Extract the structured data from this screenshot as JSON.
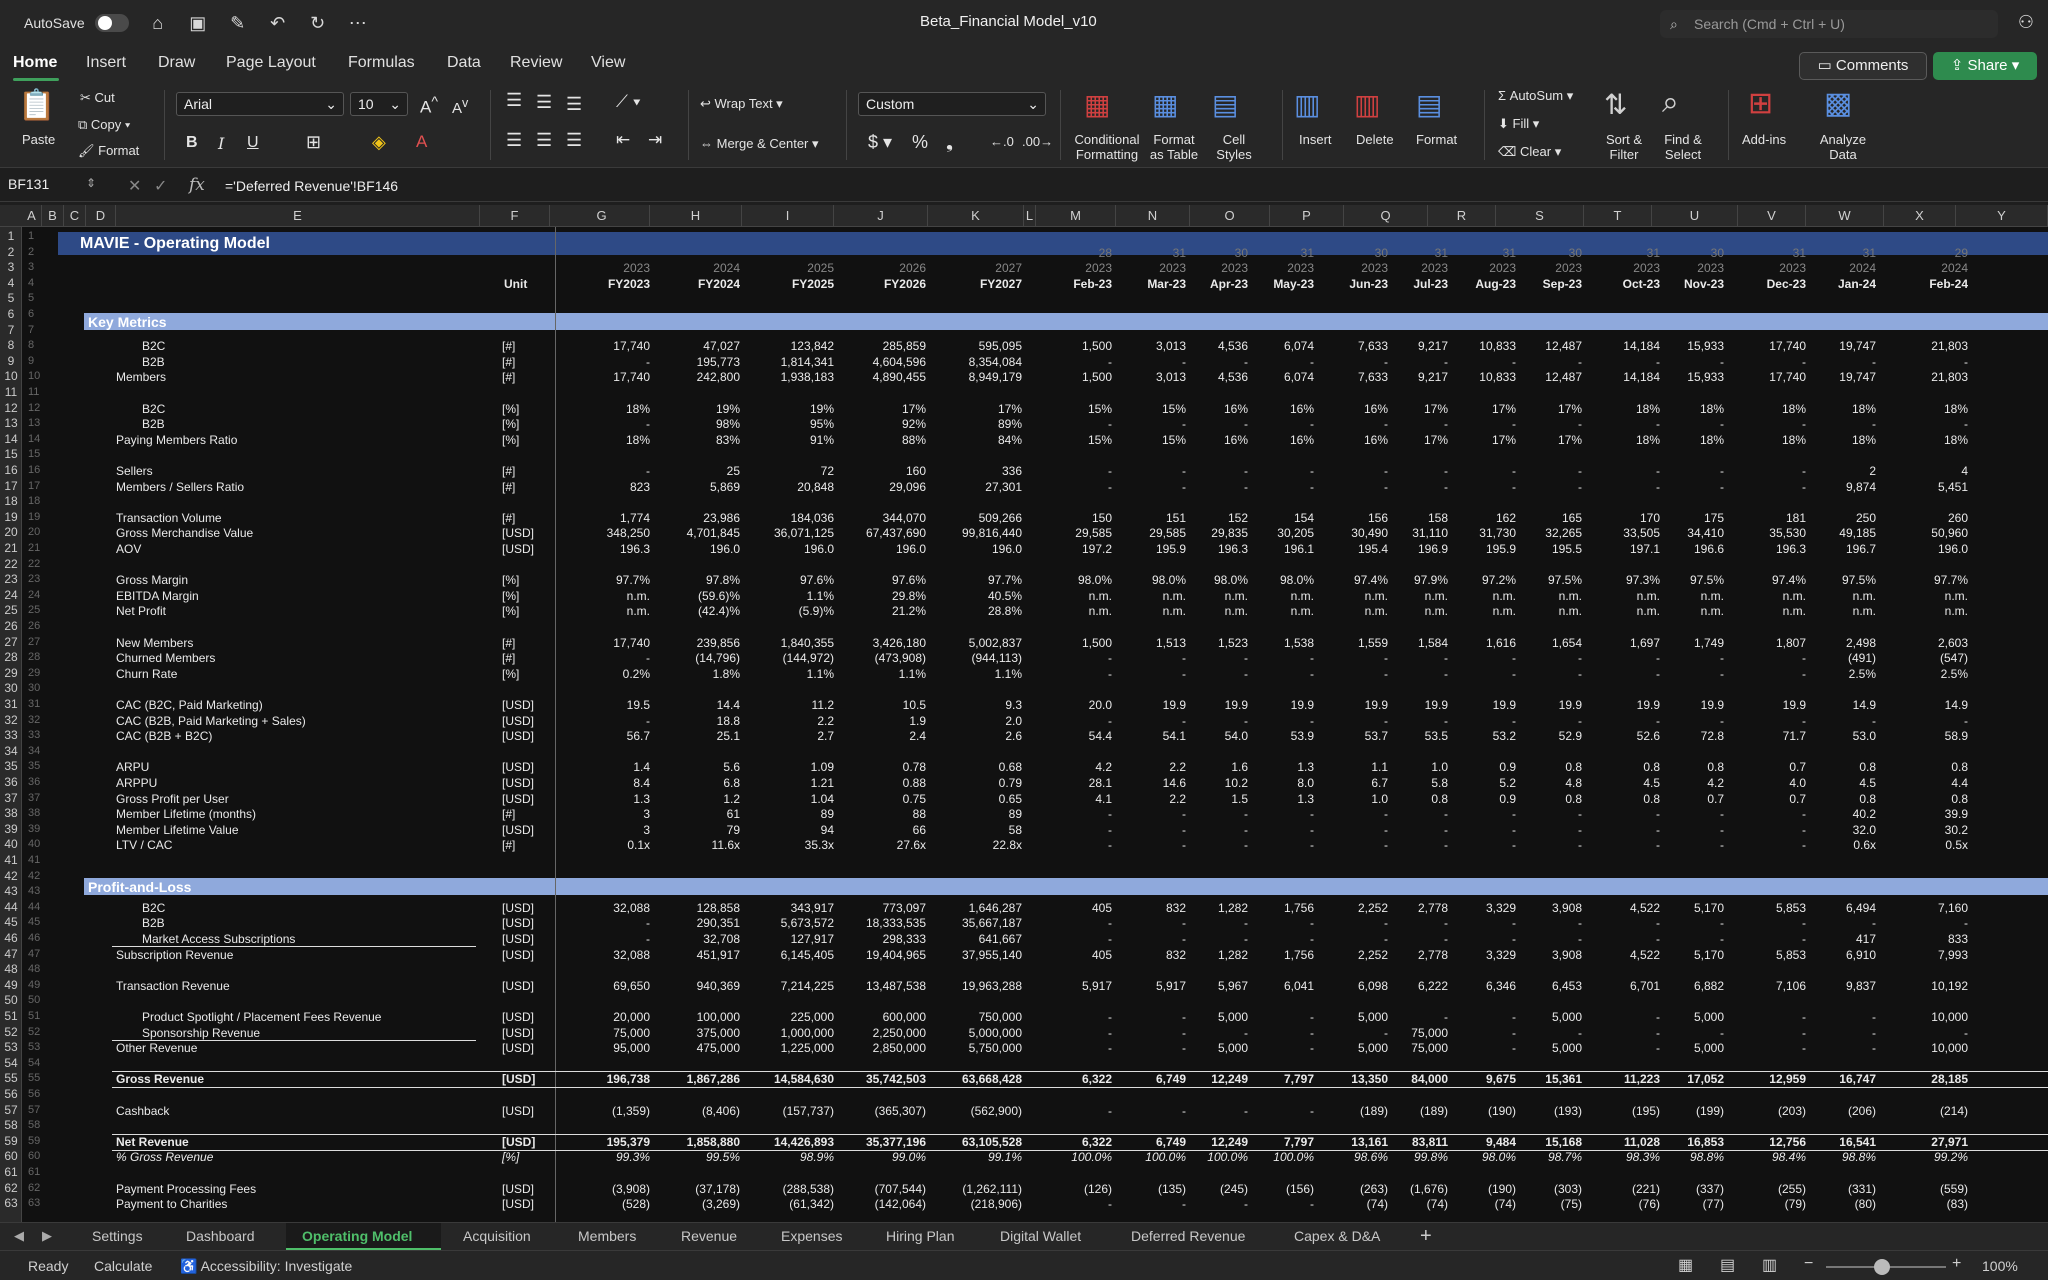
{
  "titlebar": {
    "autosave_label": "AutoSave",
    "document_title": "Beta_Financial Model_v10",
    "search_placeholder": "Search (Cmd + Ctrl + U)"
  },
  "menu": {
    "tabs": [
      "Home",
      "Insert",
      "Draw",
      "Page Layout",
      "Formulas",
      "Data",
      "Review",
      "View"
    ],
    "active": "Home",
    "comments_label": "Comments",
    "share_label": "Share"
  },
  "ribbon": {
    "paste": "Paste",
    "cut": "Cut",
    "copy": "Copy",
    "format": "Format",
    "font_name": "Arial",
    "font_size": "10",
    "wrap_text": "Wrap Text",
    "merge_center": "Merge & Center",
    "number_format": "Custom",
    "conditional_formatting": "Conditional\nFormatting",
    "format_as_table": "Format\nas Table",
    "cell_styles": "Cell\nStyles",
    "insert": "Insert",
    "delete": "Delete",
    "format_cells": "Format",
    "autosum": "AutoSum",
    "fill": "Fill",
    "clear": "Clear",
    "sort_filter": "Sort &\nFilter",
    "find_select": "Find &\nSelect",
    "addins": "Add-ins",
    "analyze_data": "Analyze\nData"
  },
  "formula_bar": {
    "name_box": "BF131",
    "formula": "='Deferred Revenue'!BF146"
  },
  "columns": [
    "A",
    "B",
    "C",
    "D",
    "E",
    "F",
    "G",
    "H",
    "I",
    "J",
    "K",
    "L",
    "M",
    "N",
    "O",
    "P",
    "Q",
    "R",
    "S",
    "T",
    "U",
    "V",
    "W",
    "X",
    "Y"
  ],
  "header_rows": {
    "days": [
      "28",
      "31",
      "30",
      "31",
      "30",
      "31",
      "31",
      "30",
      "31",
      "30",
      "31",
      "31",
      "29"
    ],
    "years": [
      "2023",
      "2024",
      "2025",
      "2026",
      "2027",
      "2023",
      "2023",
      "2023",
      "2023",
      "2023",
      "2023",
      "2023",
      "2023",
      "2023",
      "2023",
      "2023",
      "2024",
      "2024"
    ],
    "unit_label": "Unit",
    "periods": [
      "FY2023",
      "FY2024",
      "FY2025",
      "FY2026",
      "FY2027",
      "Feb-23",
      "Mar-23",
      "Apr-23",
      "May-23",
      "Jun-23",
      "Jul-23",
      "Aug-23",
      "Sep-23",
      "Oct-23",
      "Nov-23",
      "Dec-23",
      "Jan-24",
      "Feb-24"
    ]
  },
  "banner_title": "MAVIE - Operating Model",
  "sections": {
    "key_metrics": "Key Metrics",
    "pnl": "Profit-and-Loss"
  },
  "rows": [
    {
      "r": 8,
      "indent": 2,
      "label": "B2C",
      "unit": "[#]",
      "v": [
        "17,740",
        "47,027",
        "123,842",
        "285,859",
        "595,095",
        "1,500",
        "3,013",
        "4,536",
        "6,074",
        "7,633",
        "9,217",
        "10,833",
        "12,487",
        "14,184",
        "15,933",
        "17,740",
        "19,747",
        "21,803"
      ]
    },
    {
      "r": 9,
      "indent": 2,
      "label": "B2B",
      "unit": "[#]",
      "v": [
        "-",
        "195,773",
        "1,814,341",
        "4,604,596",
        "8,354,084",
        "-",
        "-",
        "-",
        "-",
        "-",
        "-",
        "-",
        "-",
        "-",
        "-",
        "-",
        "-",
        "-"
      ]
    },
    {
      "r": 10,
      "indent": 1,
      "label": "Members",
      "unit": "[#]",
      "v": [
        "17,740",
        "242,800",
        "1,938,183",
        "4,890,455",
        "8,949,179",
        "1,500",
        "3,013",
        "4,536",
        "6,074",
        "7,633",
        "9,217",
        "10,833",
        "12,487",
        "14,184",
        "15,933",
        "17,740",
        "19,747",
        "21,803"
      ]
    },
    {
      "r": 12,
      "indent": 2,
      "label": "B2C",
      "unit": "[%]",
      "v": [
        "18%",
        "19%",
        "19%",
        "17%",
        "17%",
        "15%",
        "15%",
        "16%",
        "16%",
        "16%",
        "17%",
        "17%",
        "17%",
        "18%",
        "18%",
        "18%",
        "18%",
        "18%"
      ]
    },
    {
      "r": 13,
      "indent": 2,
      "label": "B2B",
      "unit": "[%]",
      "v": [
        "-",
        "98%",
        "95%",
        "92%",
        "89%",
        "-",
        "-",
        "-",
        "-",
        "-",
        "-",
        "-",
        "-",
        "-",
        "-",
        "-",
        "-",
        "-"
      ]
    },
    {
      "r": 14,
      "indent": 1,
      "label": "Paying Members Ratio",
      "unit": "[%]",
      "v": [
        "18%",
        "83%",
        "91%",
        "88%",
        "84%",
        "15%",
        "15%",
        "16%",
        "16%",
        "16%",
        "17%",
        "17%",
        "17%",
        "18%",
        "18%",
        "18%",
        "18%",
        "18%"
      ]
    },
    {
      "r": 16,
      "indent": 1,
      "label": "Sellers",
      "unit": "[#]",
      "v": [
        "-",
        "25",
        "72",
        "160",
        "336",
        "-",
        "-",
        "-",
        "-",
        "-",
        "-",
        "-",
        "-",
        "-",
        "-",
        "-",
        "2",
        "4"
      ]
    },
    {
      "r": 17,
      "indent": 1,
      "label": "Members / Sellers Ratio",
      "unit": "[#]",
      "v": [
        "823",
        "5,869",
        "20,848",
        "29,096",
        "27,301",
        "-",
        "-",
        "-",
        "-",
        "-",
        "-",
        "-",
        "-",
        "-",
        "-",
        "-",
        "9,874",
        "5,451"
      ]
    },
    {
      "r": 19,
      "indent": 1,
      "label": "Transaction Volume",
      "unit": "[#]",
      "v": [
        "1,774",
        "23,986",
        "184,036",
        "344,070",
        "509,266",
        "150",
        "151",
        "152",
        "154",
        "156",
        "158",
        "162",
        "165",
        "170",
        "175",
        "181",
        "250",
        "260"
      ]
    },
    {
      "r": 20,
      "indent": 1,
      "label": "Gross Merchandise Value",
      "unit": "[USD]",
      "v": [
        "348,250",
        "4,701,845",
        "36,071,125",
        "67,437,690",
        "99,816,440",
        "29,585",
        "29,585",
        "29,835",
        "30,205",
        "30,490",
        "31,110",
        "31,730",
        "32,265",
        "33,505",
        "34,410",
        "35,530",
        "49,185",
        "50,960"
      ]
    },
    {
      "r": 21,
      "indent": 1,
      "label": "AOV",
      "unit": "[USD]",
      "v": [
        "196.3",
        "196.0",
        "196.0",
        "196.0",
        "196.0",
        "197.2",
        "195.9",
        "196.3",
        "196.1",
        "195.4",
        "196.9",
        "195.9",
        "195.5",
        "197.1",
        "196.6",
        "196.3",
        "196.7",
        "196.0"
      ]
    },
    {
      "r": 23,
      "indent": 1,
      "label": "Gross Margin",
      "unit": "[%]",
      "v": [
        "97.7%",
        "97.8%",
        "97.6%",
        "97.6%",
        "97.7%",
        "98.0%",
        "98.0%",
        "98.0%",
        "98.0%",
        "97.4%",
        "97.9%",
        "97.2%",
        "97.5%",
        "97.3%",
        "97.5%",
        "97.4%",
        "97.5%",
        "97.7%"
      ]
    },
    {
      "r": 24,
      "indent": 1,
      "label": "EBITDA Margin",
      "unit": "[%]",
      "v": [
        "n.m.",
        "(59.6)%",
        "1.1%",
        "29.8%",
        "40.5%",
        "n.m.",
        "n.m.",
        "n.m.",
        "n.m.",
        "n.m.",
        "n.m.",
        "n.m.",
        "n.m.",
        "n.m.",
        "n.m.",
        "n.m.",
        "n.m.",
        "n.m."
      ]
    },
    {
      "r": 25,
      "indent": 1,
      "label": "Net Profit",
      "unit": "[%]",
      "v": [
        "n.m.",
        "(42.4)%",
        "(5.9)%",
        "21.2%",
        "28.8%",
        "n.m.",
        "n.m.",
        "n.m.",
        "n.m.",
        "n.m.",
        "n.m.",
        "n.m.",
        "n.m.",
        "n.m.",
        "n.m.",
        "n.m.",
        "n.m.",
        "n.m."
      ]
    },
    {
      "r": 27,
      "indent": 1,
      "label": "New Members",
      "unit": "[#]",
      "v": [
        "17,740",
        "239,856",
        "1,840,355",
        "3,426,180",
        "5,002,837",
        "1,500",
        "1,513",
        "1,523",
        "1,538",
        "1,559",
        "1,584",
        "1,616",
        "1,654",
        "1,697",
        "1,749",
        "1,807",
        "2,498",
        "2,603"
      ]
    },
    {
      "r": 28,
      "indent": 1,
      "label": "Churned Members",
      "unit": "[#]",
      "v": [
        "-",
        "(14,796)",
        "(144,972)",
        "(473,908)",
        "(944,113)",
        "-",
        "-",
        "-",
        "-",
        "-",
        "-",
        "-",
        "-",
        "-",
        "-",
        "-",
        "(491)",
        "(547)"
      ]
    },
    {
      "r": 29,
      "indent": 1,
      "label": "Churn Rate",
      "unit": "[%]",
      "v": [
        "0.2%",
        "1.8%",
        "1.1%",
        "1.1%",
        "1.1%",
        "-",
        "-",
        "-",
        "-",
        "-",
        "-",
        "-",
        "-",
        "-",
        "-",
        "-",
        "2.5%",
        "2.5%"
      ]
    },
    {
      "r": 31,
      "indent": 1,
      "label": "CAC (B2C, Paid Marketing)",
      "unit": "[USD]",
      "v": [
        "19.5",
        "14.4",
        "11.2",
        "10.5",
        "9.3",
        "20.0",
        "19.9",
        "19.9",
        "19.9",
        "19.9",
        "19.9",
        "19.9",
        "19.9",
        "19.9",
        "19.9",
        "19.9",
        "14.9",
        "14.9"
      ]
    },
    {
      "r": 32,
      "indent": 1,
      "label": "CAC (B2B, Paid Marketing + Sales)",
      "unit": "[USD]",
      "v": [
        "-",
        "18.8",
        "2.2",
        "1.9",
        "2.0",
        "-",
        "-",
        "-",
        "-",
        "-",
        "-",
        "-",
        "-",
        "-",
        "-",
        "-",
        "-",
        "-"
      ]
    },
    {
      "r": 33,
      "indent": 1,
      "label": "CAC (B2B + B2C)",
      "unit": "[USD]",
      "v": [
        "56.7",
        "25.1",
        "2.7",
        "2.4",
        "2.6",
        "54.4",
        "54.1",
        "54.0",
        "53.9",
        "53.7",
        "53.5",
        "53.2",
        "52.9",
        "52.6",
        "72.8",
        "71.7",
        "53.0",
        "58.9"
      ]
    },
    {
      "r": 35,
      "indent": 1,
      "label": "ARPU",
      "unit": "[USD]",
      "v": [
        "1.4",
        "5.6",
        "1.09",
        "0.78",
        "0.68",
        "4.2",
        "2.2",
        "1.6",
        "1.3",
        "1.1",
        "1.0",
        "0.9",
        "0.8",
        "0.8",
        "0.8",
        "0.7",
        "0.8",
        "0.8"
      ]
    },
    {
      "r": 36,
      "indent": 1,
      "label": "ARPPU",
      "unit": "[USD]",
      "v": [
        "8.4",
        "6.8",
        "1.21",
        "0.88",
        "0.79",
        "28.1",
        "14.6",
        "10.2",
        "8.0",
        "6.7",
        "5.8",
        "5.2",
        "4.8",
        "4.5",
        "4.2",
        "4.0",
        "4.5",
        "4.4"
      ]
    },
    {
      "r": 37,
      "indent": 1,
      "label": "Gross Profit per User",
      "unit": "[USD]",
      "v": [
        "1.3",
        "1.2",
        "1.04",
        "0.75",
        "0.65",
        "4.1",
        "2.2",
        "1.5",
        "1.3",
        "1.0",
        "0.8",
        "0.9",
        "0.8",
        "0.8",
        "0.7",
        "0.7",
        "0.8",
        "0.8"
      ]
    },
    {
      "r": 38,
      "indent": 1,
      "label": "Member Lifetime (months)",
      "unit": "[#]",
      "v": [
        "3",
        "61",
        "89",
        "88",
        "89",
        "-",
        "-",
        "-",
        "-",
        "-",
        "-",
        "-",
        "-",
        "-",
        "-",
        "-",
        "40.2",
        "39.9"
      ]
    },
    {
      "r": 39,
      "indent": 1,
      "label": "Member Lifetime Value",
      "unit": "[USD]",
      "v": [
        "3",
        "79",
        "94",
        "66",
        "58",
        "-",
        "-",
        "-",
        "-",
        "-",
        "-",
        "-",
        "-",
        "-",
        "-",
        "-",
        "32.0",
        "30.2"
      ]
    },
    {
      "r": 40,
      "indent": 1,
      "label": "LTV / CAC",
      "unit": "[#]",
      "v": [
        "0.1x",
        "11.6x",
        "35.3x",
        "27.6x",
        "22.8x",
        "-",
        "-",
        "-",
        "-",
        "-",
        "-",
        "-",
        "-",
        "-",
        "-",
        "-",
        "0.6x",
        "0.5x"
      ]
    },
    {
      "r": 44,
      "indent": 2,
      "label": "B2C",
      "unit": "[USD]",
      "v": [
        "32,088",
        "128,858",
        "343,917",
        "773,097",
        "1,646,287",
        "405",
        "832",
        "1,282",
        "1,756",
        "2,252",
        "2,778",
        "3,329",
        "3,908",
        "4,522",
        "5,170",
        "5,853",
        "6,494",
        "7,160"
      ]
    },
    {
      "r": 45,
      "indent": 2,
      "label": "B2B",
      "unit": "[USD]",
      "v": [
        "-",
        "290,351",
        "5,673,572",
        "18,333,535",
        "35,667,187",
        "-",
        "-",
        "-",
        "-",
        "-",
        "-",
        "-",
        "-",
        "-",
        "-",
        "-",
        "-",
        "-"
      ]
    },
    {
      "r": 46,
      "indent": 2,
      "label": "Market Access Subscriptions",
      "unit": "[USD]",
      "underline": true,
      "v": [
        "-",
        "32,708",
        "127,917",
        "298,333",
        "641,667",
        "-",
        "-",
        "-",
        "-",
        "-",
        "-",
        "-",
        "-",
        "-",
        "-",
        "-",
        "417",
        "833"
      ]
    },
    {
      "r": 47,
      "indent": 1,
      "label": "Subscription Revenue",
      "unit": "[USD]",
      "v": [
        "32,088",
        "451,917",
        "6,145,405",
        "19,404,965",
        "37,955,140",
        "405",
        "832",
        "1,282",
        "1,756",
        "2,252",
        "2,778",
        "3,329",
        "3,908",
        "4,522",
        "5,170",
        "5,853",
        "6,910",
        "7,993"
      ]
    },
    {
      "r": 49,
      "indent": 1,
      "label": "Transaction Revenue",
      "unit": "[USD]",
      "v": [
        "69,650",
        "940,369",
        "7,214,225",
        "13,487,538",
        "19,963,288",
        "5,917",
        "5,917",
        "5,967",
        "6,041",
        "6,098",
        "6,222",
        "6,346",
        "6,453",
        "6,701",
        "6,882",
        "7,106",
        "9,837",
        "10,192"
      ]
    },
    {
      "r": 51,
      "indent": 2,
      "label": "Product Spotlight / Placement Fees Revenue",
      "unit": "[USD]",
      "v": [
        "20,000",
        "100,000",
        "225,000",
        "600,000",
        "750,000",
        "-",
        "-",
        "5,000",
        "-",
        "5,000",
        "-",
        "-",
        "5,000",
        "-",
        "5,000",
        "-",
        "-",
        "10,000"
      ]
    },
    {
      "r": 52,
      "indent": 2,
      "label": "Sponsorship Revenue",
      "unit": "[USD]",
      "underline": true,
      "v": [
        "75,000",
        "375,000",
        "1,000,000",
        "2,250,000",
        "5,000,000",
        "-",
        "-",
        "-",
        "-",
        "-",
        "75,000",
        "-",
        "-",
        "-",
        "-",
        "-",
        "-",
        "-"
      ]
    },
    {
      "r": 53,
      "indent": 1,
      "label": "Other Revenue",
      "unit": "[USD]",
      "v": [
        "95,000",
        "475,000",
        "1,225,000",
        "2,850,000",
        "5,750,000",
        "-",
        "-",
        "5,000",
        "-",
        "5,000",
        "75,000",
        "-",
        "5,000",
        "-",
        "5,000",
        "-",
        "-",
        "10,000"
      ]
    },
    {
      "r": 55,
      "indent": 1,
      "label": "Gross Revenue",
      "unit": "[USD]",
      "bold": true,
      "boxed": true,
      "v": [
        "196,738",
        "1,867,286",
        "14,584,630",
        "35,742,503",
        "63,668,428",
        "6,322",
        "6,749",
        "12,249",
        "7,797",
        "13,350",
        "84,000",
        "9,675",
        "15,361",
        "11,223",
        "17,052",
        "12,959",
        "16,747",
        "28,185"
      ]
    },
    {
      "r": 57,
      "indent": 1,
      "label": "Cashback",
      "unit": "[USD]",
      "v": [
        "(1,359)",
        "(8,406)",
        "(157,737)",
        "(365,307)",
        "(562,900)",
        "-",
        "-",
        "-",
        "-",
        "(189)",
        "(189)",
        "(190)",
        "(193)",
        "(195)",
        "(199)",
        "(203)",
        "(206)",
        "(214)"
      ]
    },
    {
      "r": 59,
      "indent": 1,
      "label": "Net Revenue",
      "unit": "[USD]",
      "bold": true,
      "boxed": true,
      "v": [
        "195,379",
        "1,858,880",
        "14,426,893",
        "35,377,196",
        "63,105,528",
        "6,322",
        "6,749",
        "12,249",
        "7,797",
        "13,161",
        "83,811",
        "9,484",
        "15,168",
        "11,028",
        "16,853",
        "12,756",
        "16,541",
        "27,971"
      ]
    },
    {
      "r": 60,
      "indent": 1,
      "label": "% Gross Revenue",
      "unit": "[%]",
      "italic": true,
      "v": [
        "99.3%",
        "99.5%",
        "98.9%",
        "99.0%",
        "99.1%",
        "100.0%",
        "100.0%",
        "100.0%",
        "100.0%",
        "98.6%",
        "99.8%",
        "98.0%",
        "98.7%",
        "98.3%",
        "98.8%",
        "98.4%",
        "98.8%",
        "99.2%"
      ]
    },
    {
      "r": 62,
      "indent": 1,
      "label": "Payment Processing Fees",
      "unit": "[USD]",
      "v": [
        "(3,908)",
        "(37,178)",
        "(288,538)",
        "(707,544)",
        "(1,262,111)",
        "(126)",
        "(135)",
        "(245)",
        "(156)",
        "(263)",
        "(1,676)",
        "(190)",
        "(303)",
        "(221)",
        "(337)",
        "(255)",
        "(331)",
        "(559)"
      ]
    },
    {
      "r": 63,
      "indent": 1,
      "label": "Payment to Charities",
      "unit": "[USD]",
      "v": [
        "(528)",
        "(3,269)",
        "(61,342)",
        "(142,064)",
        "(218,906)",
        "-",
        "-",
        "-",
        "-",
        "(74)",
        "(74)",
        "(74)",
        "(75)",
        "(76)",
        "(77)",
        "(79)",
        "(80)",
        "(83)"
      ]
    }
  ],
  "sheet_tabs": [
    "Settings",
    "Dashboard",
    "Operating Model",
    "Acquisition",
    "Members",
    "Revenue",
    "Expenses",
    "Hiring Plan",
    "Digital Wallet",
    "Deferred Revenue",
    "Capex & D&A"
  ],
  "active_sheet": "Operating Model",
  "status": {
    "ready": "Ready",
    "calculate": "Calculate",
    "accessibility": "Accessibility: Investigate",
    "zoom": "100%"
  },
  "colors": {
    "banner": "#2e4a86",
    "section": "#8fa9dc",
    "accent_green": "#2e8b4e"
  }
}
